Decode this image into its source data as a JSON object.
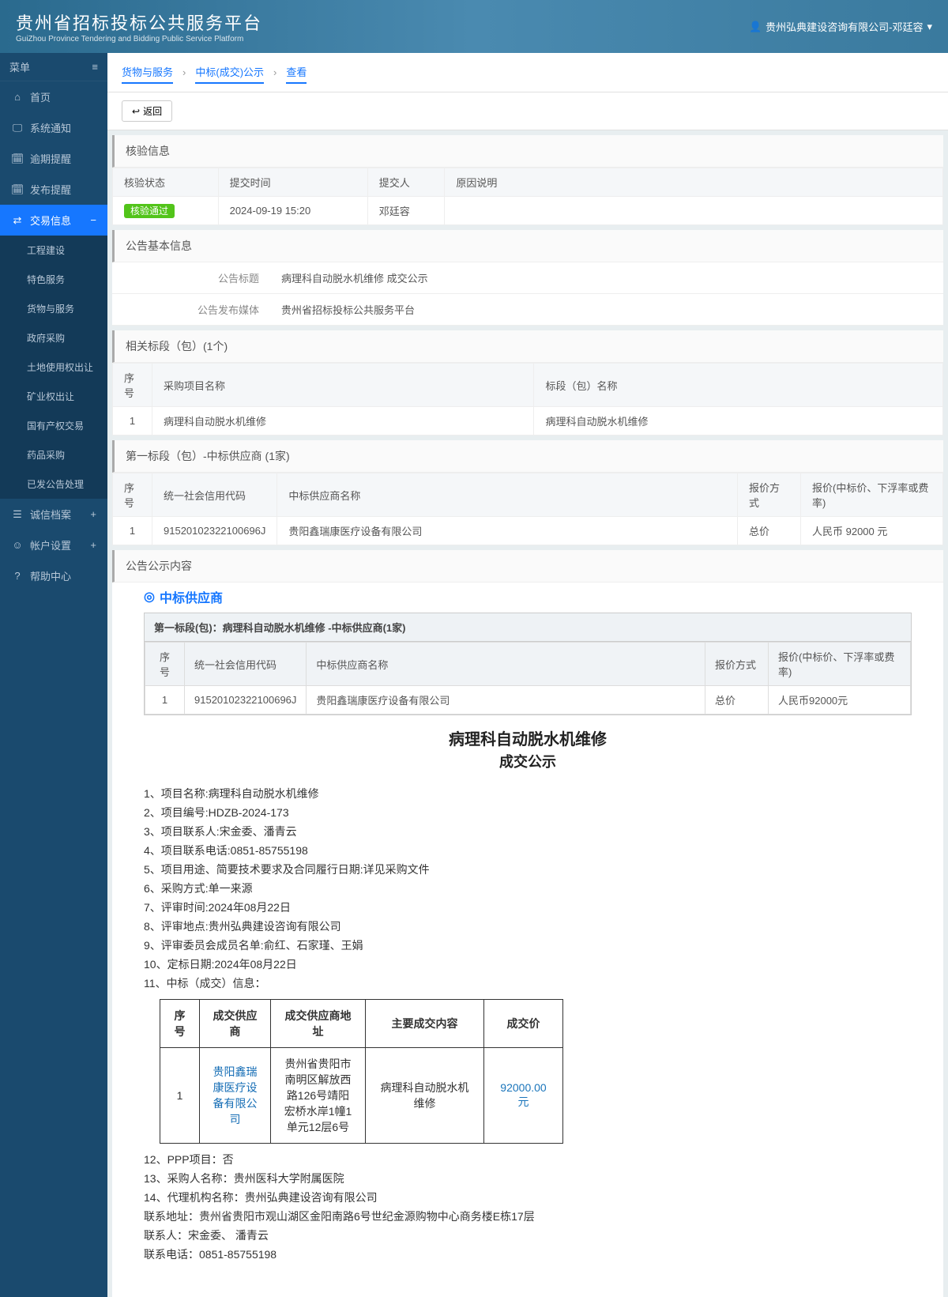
{
  "header": {
    "title": "贵州省招标投标公共服务平台",
    "subtitle": "GuiZhou Province Tendering and Bidding Public Service Platform",
    "user": "贵州弘典建设咨询有限公司-邓廷容"
  },
  "sidebar": {
    "menu_label": "菜单",
    "items": [
      "首页",
      "系统通知",
      "逾期提醒",
      "发布提醒",
      "交易信息",
      "诚信档案",
      "帐户设置",
      "帮助中心"
    ],
    "sub": [
      "工程建设",
      "特色服务",
      "货物与服务",
      "政府采购",
      "土地使用权出让",
      "矿业权出让",
      "国有产权交易",
      "药品采购",
      "已发公告处理"
    ]
  },
  "breadcrumb": [
    "货物与服务",
    "中标(成交)公示",
    "查看"
  ],
  "back": "返回",
  "panel1": {
    "title": "核验信息",
    "headers": [
      "核验状态",
      "提交时间",
      "提交人",
      "原因说明"
    ],
    "row": {
      "status": "核验通过",
      "time": "2024-09-19 15:20",
      "person": "邓廷容",
      "reason": ""
    }
  },
  "panel2": {
    "title": "公告基本信息",
    "rows": [
      {
        "label": "公告标题",
        "value": "病理科自动脱水机维修 成交公示"
      },
      {
        "label": "公告发布媒体",
        "value": "贵州省招标投标公共服务平台"
      }
    ]
  },
  "panel3": {
    "title": "相关标段（包）(1个)",
    "headers": [
      "序号",
      "采购项目名称",
      "标段（包）名称"
    ],
    "row": [
      "1",
      "病理科自动脱水机维修",
      "病理科自动脱水机维修"
    ]
  },
  "panel4": {
    "title": "第一标段（包）-中标供应商 (1家)",
    "headers": [
      "序号",
      "统一社会信用代码",
      "中标供应商名称",
      "报价方式",
      "报价(中标价、下浮率或费率)"
    ],
    "row": [
      "1",
      "91520102322100696J",
      "贵阳鑫瑞康医疗设备有限公司",
      "总价",
      "人民币 92000 元"
    ]
  },
  "panel5": {
    "title": "公告公示内容",
    "sup_title": "中标供应商",
    "caption": "第一标段(包)：病理科自动脱水机维修 -中标供应商(1家)",
    "headers": [
      "序号",
      "统一社会信用代码",
      "中标供应商名称",
      "报价方式",
      "报价(中标价、下浮率或费率)"
    ],
    "row": [
      "1",
      "91520102322100696J",
      "贵阳鑫瑞康医疗设备有限公司",
      "总价",
      "人民币92000元"
    ]
  },
  "doc": {
    "title": "病理科自动脱水机维修",
    "subtitle": "成交公示",
    "lines": [
      "1、项目名称:病理科自动脱水机维修",
      "2、项目编号:HDZB-2024-173",
      "3、项目联系人:宋金委、潘青云",
      "4、项目联系电话:0851-85755198",
      "5、项目用途、简要技术要求及合同履行日期:详见采购文件",
      "6、采购方式:单一来源",
      "7、评审时间:2024年08月22日",
      "8、评审地点:贵州弘典建设咨询有限公司",
      "9、评审委员会成员名单:俞红、石家瑾、王娟",
      "10、定标日期:2024年08月22日",
      "11、中标（成交）信息："
    ],
    "table": {
      "headers": [
        "序号",
        "成交供应商",
        "成交供应商地址",
        "主要成交内容",
        "成交价"
      ],
      "row": {
        "no": "1",
        "supplier": "贵阳鑫瑞康医疗设备有限公司",
        "addr": "贵州省贵阳市南明区解放西路126号靖阳宏桥水岸1幢1单元12层6号",
        "content": "病理科自动脱水机维修",
        "price": "92000.00元"
      }
    },
    "after": [
      "12、PPP项目：否",
      "13、采购人名称：贵州医科大学附属医院",
      "14、代理机构名称：贵州弘典建设咨询有限公司",
      "联系地址：贵州省贵阳市观山湖区金阳南路6号世纪金源购物中心商务楼E栋17层",
      "联系人：宋金委、 潘青云",
      "联系电话：0851-85755198"
    ]
  }
}
